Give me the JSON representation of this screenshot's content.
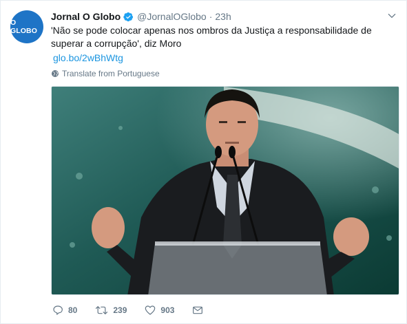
{
  "account": {
    "avatar_text": "O GLOBO",
    "name": "Jornal O Globo",
    "handle": "@JornalOGlobo",
    "separator": "·",
    "time": "23h",
    "verified": true
  },
  "tweet": {
    "text": "'Não se pode colocar apenas nos ombros da Justiça a responsabilidade de superar a corrupção', diz Moro",
    "link": "glo.bo/2wBhWtg",
    "translate_label": "Translate from Portuguese"
  },
  "actions": {
    "replies": "80",
    "retweets": "239",
    "likes": "903"
  },
  "icons": {
    "caret": "chevron-down-icon",
    "globe": "globe-icon",
    "reply": "reply-icon",
    "retweet": "retweet-icon",
    "like": "heart-icon",
    "dm": "envelope-icon"
  },
  "colors": {
    "brand_blue": "#1da1f2",
    "avatar_blue": "#1e74c6",
    "link_blue": "#1b95e0",
    "muted_gray": "#657786"
  }
}
